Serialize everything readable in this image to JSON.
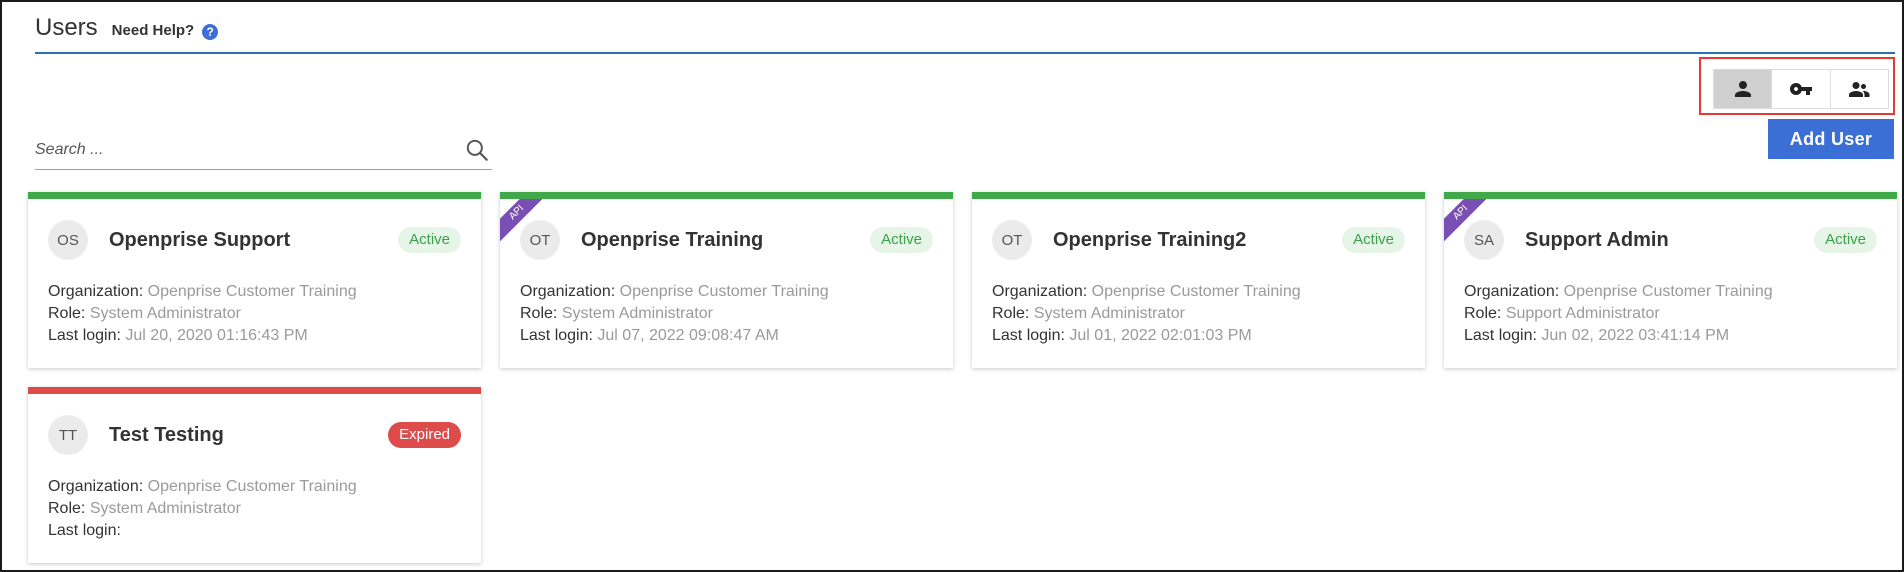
{
  "header": {
    "title": "Users",
    "help_label": "Need Help?",
    "help_icon": "?"
  },
  "view_switcher": {
    "items": [
      {
        "icon": "person-icon",
        "active": true
      },
      {
        "icon": "key-icon",
        "active": false
      },
      {
        "icon": "people-icon",
        "active": false
      }
    ],
    "highlight_color": "#e53935"
  },
  "search": {
    "placeholder": "Search ...",
    "value": ""
  },
  "toolbar": {
    "add_user_label": "Add User"
  },
  "colors": {
    "accent": "#3b6fd6",
    "active_bar": "#3fa848",
    "expired_bar": "#dd4b4b",
    "api_ribbon": "#7a4fb3"
  },
  "users": [
    {
      "initials": "OS",
      "name": "Openprise Support",
      "status": "Active",
      "api": false,
      "organization_label": "Organization:",
      "organization": "Openprise Customer Training",
      "role_label": "Role:",
      "role": "System Administrator",
      "last_login_label": "Last login:",
      "last_login": "Jul 20, 2020 01:16:43 PM"
    },
    {
      "initials": "OT",
      "name": "Openprise Training",
      "status": "Active",
      "api": true,
      "api_label": "API",
      "organization_label": "Organization:",
      "organization": "Openprise Customer Training",
      "role_label": "Role:",
      "role": "System Administrator",
      "last_login_label": "Last login:",
      "last_login": "Jul 07, 2022 09:08:47 AM"
    },
    {
      "initials": "OT",
      "name": "Openprise Training2",
      "status": "Active",
      "api": false,
      "organization_label": "Organization:",
      "organization": "Openprise Customer Training",
      "role_label": "Role:",
      "role": "System Administrator",
      "last_login_label": "Last login:",
      "last_login": "Jul 01, 2022 02:01:03 PM"
    },
    {
      "initials": "SA",
      "name": "Support Admin",
      "status": "Active",
      "api": true,
      "api_label": "API",
      "organization_label": "Organization:",
      "organization": "Openprise Customer Training",
      "role_label": "Role:",
      "role": "Support Administrator",
      "last_login_label": "Last login:",
      "last_login": "Jun 02, 2022 03:41:14 PM"
    },
    {
      "initials": "TT",
      "name": "Test Testing",
      "status": "Expired",
      "api": false,
      "organization_label": "Organization:",
      "organization": "Openprise Customer Training",
      "role_label": "Role:",
      "role": "System Administrator",
      "last_login_label": "Last login:",
      "last_login": ""
    }
  ]
}
